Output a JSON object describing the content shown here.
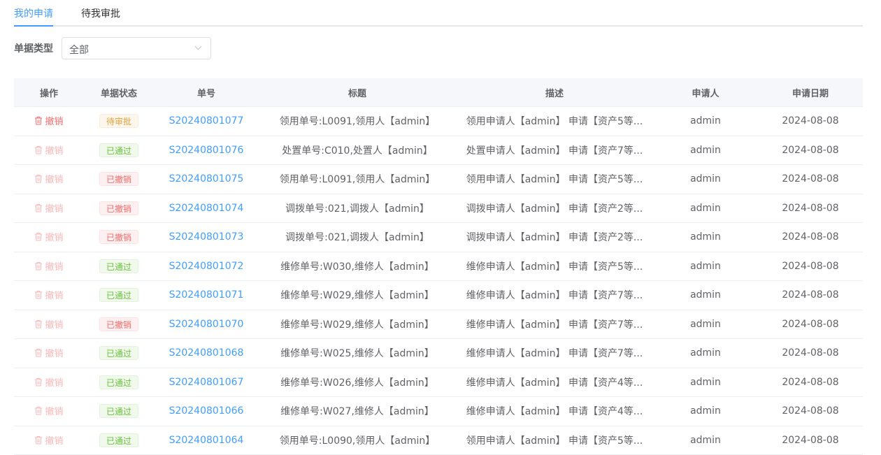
{
  "tabs": [
    {
      "label": "我的申请",
      "active": true
    },
    {
      "label": "待我审批",
      "active": false
    }
  ],
  "filter": {
    "label": "单据类型",
    "value": "全部"
  },
  "columns": [
    "操作",
    "单据状态",
    "单号",
    "标题",
    "描述",
    "申请人",
    "申请日期"
  ],
  "rows": [
    {
      "action": "撤销",
      "action_enabled": true,
      "status": "待审批",
      "status_type": "pending",
      "no": "S20240801077",
      "title": "领用单号:L0091,领用人【admin】",
      "desc": "领用申请人【admin】 申请【资产5等...",
      "applicant": "admin",
      "date": "2024-08-08"
    },
    {
      "action": "撤销",
      "action_enabled": false,
      "status": "已通过",
      "status_type": "passed",
      "no": "S20240801076",
      "title": "处置单号:C010,处置人【admin】",
      "desc": "处置申请人【admin】 申请【资产7等...",
      "applicant": "admin",
      "date": "2024-08-08"
    },
    {
      "action": "撤销",
      "action_enabled": false,
      "status": "已撤销",
      "status_type": "revoked",
      "no": "S20240801075",
      "title": "领用单号:L0091,领用人【admin】",
      "desc": "领用申请人【admin】 申请【资产5等...",
      "applicant": "admin",
      "date": "2024-08-08"
    },
    {
      "action": "撤销",
      "action_enabled": false,
      "status": "已撤销",
      "status_type": "revoked",
      "no": "S20240801074",
      "title": "调拨单号:021,调拨人【admin】",
      "desc": "调拨申请人【admin】 申请【资产2等...",
      "applicant": "admin",
      "date": "2024-08-08"
    },
    {
      "action": "撤销",
      "action_enabled": false,
      "status": "已撤销",
      "status_type": "revoked",
      "no": "S20240801073",
      "title": "调拨单号:021,调拨人【admin】",
      "desc": "调拨申请人【admin】 申请【资产2等...",
      "applicant": "admin",
      "date": "2024-08-08"
    },
    {
      "action": "撤销",
      "action_enabled": false,
      "status": "已通过",
      "status_type": "passed",
      "no": "S20240801072",
      "title": "维修单号:W030,维修人【admin】",
      "desc": "维修申请人【admin】 申请【资产5等...",
      "applicant": "admin",
      "date": "2024-08-08"
    },
    {
      "action": "撤销",
      "action_enabled": false,
      "status": "已通过",
      "status_type": "passed",
      "no": "S20240801071",
      "title": "维修单号:W029,维修人【admin】",
      "desc": "维修申请人【admin】 申请【资产7等...",
      "applicant": "admin",
      "date": "2024-08-08"
    },
    {
      "action": "撤销",
      "action_enabled": false,
      "status": "已撤销",
      "status_type": "revoked",
      "no": "S20240801070",
      "title": "维修单号:W029,维修人【admin】",
      "desc": "维修申请人【admin】 申请【资产7等...",
      "applicant": "admin",
      "date": "2024-08-08"
    },
    {
      "action": "撤销",
      "action_enabled": false,
      "status": "已通过",
      "status_type": "passed",
      "no": "S20240801068",
      "title": "维修单号:W025,维修人【admin】",
      "desc": "维修申请人【admin】 申请【资产7等...",
      "applicant": "admin",
      "date": "2024-08-08"
    },
    {
      "action": "撤销",
      "action_enabled": false,
      "status": "已通过",
      "status_type": "passed",
      "no": "S20240801067",
      "title": "维修单号:W026,维修人【admin】",
      "desc": "维修申请人【admin】 申请【资产4等...",
      "applicant": "admin",
      "date": "2024-08-08"
    },
    {
      "action": "撤销",
      "action_enabled": false,
      "status": "已通过",
      "status_type": "passed",
      "no": "S20240801066",
      "title": "维修单号:W027,维修人【admin】",
      "desc": "维修申请人【admin】 申请【资产4等...",
      "applicant": "admin",
      "date": "2024-08-08"
    },
    {
      "action": "撤销",
      "action_enabled": false,
      "status": "已通过",
      "status_type": "passed",
      "no": "S20240801064",
      "title": "领用单号:L0090,领用人【admin】",
      "desc": "领用申请人【admin】 申请【资产5等...",
      "applicant": "admin",
      "date": "2024-08-08"
    }
  ]
}
